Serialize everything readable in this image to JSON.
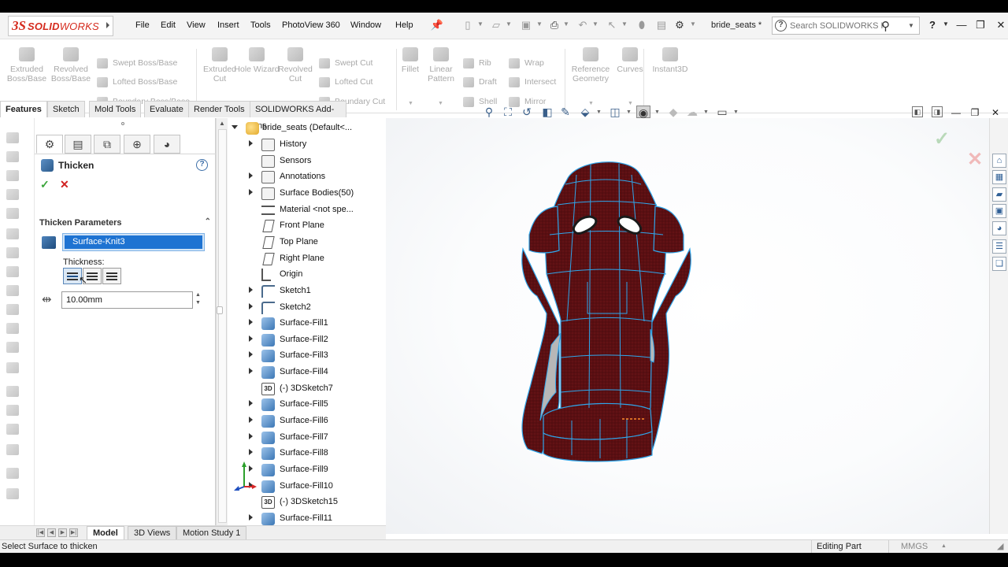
{
  "menu": {
    "brand_ds": "3S",
    "brand_solid": "SOLID",
    "brand_works": "WORKS",
    "items": [
      "File",
      "Edit",
      "View",
      "Insert",
      "Tools",
      "PhotoView 360",
      "Window",
      "Help"
    ],
    "document_title": "bride_seats *",
    "search_placeholder": "Search SOLIDWORKS Help"
  },
  "command_manager": {
    "extruded_boss": "Extruded Boss/Base",
    "revolved_boss": "Revolved Boss/Base",
    "swept_boss": "Swept Boss/Base",
    "lofted_boss": "Lofted Boss/Base",
    "boundary_boss": "Boundary Boss/Base",
    "extruded_cut": "Extruded Cut",
    "hole_wizard": "Hole Wizard",
    "revolved_cut": "Revolved Cut",
    "swept_cut": "Swept Cut",
    "lofted_cut": "Lofted Cut",
    "boundary_cut": "Boundary Cut",
    "fillet": "Fillet",
    "linear_pattern": "Linear Pattern",
    "rib": "Rib",
    "draft": "Draft",
    "shell": "Shell",
    "wrap": "Wrap",
    "intersect": "Intersect",
    "mirror": "Mirror",
    "reference_geometry": "Reference Geometry",
    "curves": "Curves",
    "instant3d": "Instant3D"
  },
  "tabs": [
    "Features",
    "Sketch",
    "Mold Tools",
    "Evaluate",
    "Render Tools",
    "SOLIDWORKS Add-Ins"
  ],
  "property_manager": {
    "title": "Thicken",
    "help": "?",
    "ok": "✓",
    "cancel": "✕",
    "group_title": "Thicken Parameters",
    "selected_face": "Surface-Knit3",
    "thickness_label": "Thickness:",
    "thickness_value": "10.00mm"
  },
  "feature_tree": {
    "root": "bride_seats  (Default<...",
    "items": [
      {
        "label": "History",
        "icon": "history-icon"
      },
      {
        "label": "Sensors",
        "icon": "sensors-icon"
      },
      {
        "label": "Annotations",
        "icon": "annotations-icon"
      },
      {
        "label": "Surface Bodies(50)",
        "icon": "surface-bodies-icon"
      },
      {
        "label": "Material <not spe...",
        "icon": "material-icon"
      },
      {
        "label": "Front Plane",
        "icon": "plane-icon"
      },
      {
        "label": "Top Plane",
        "icon": "plane-icon"
      },
      {
        "label": "Right Plane",
        "icon": "plane-icon"
      },
      {
        "label": "Origin",
        "icon": "origin-icon"
      },
      {
        "label": "Sketch1",
        "icon": "sketch-icon"
      },
      {
        "label": "Sketch2",
        "icon": "sketch-icon"
      },
      {
        "label": "Surface-Fill1",
        "icon": "surface-fill-icon"
      },
      {
        "label": "Surface-Fill2",
        "icon": "surface-fill-icon"
      },
      {
        "label": "Surface-Fill3",
        "icon": "surface-fill-icon"
      },
      {
        "label": "Surface-Fill4",
        "icon": "surface-fill-icon"
      },
      {
        "label": "(-) 3DSketch7",
        "icon": "3d-sketch-icon"
      },
      {
        "label": "Surface-Fill5",
        "icon": "surface-fill-icon"
      },
      {
        "label": "Surface-Fill6",
        "icon": "surface-fill-icon"
      },
      {
        "label": "Surface-Fill7",
        "icon": "surface-fill-icon"
      },
      {
        "label": "Surface-Fill8",
        "icon": "surface-fill-icon"
      },
      {
        "label": "Surface-Fill9",
        "icon": "surface-fill-icon"
      },
      {
        "label": "Surface-Fill10",
        "icon": "surface-fill-icon"
      },
      {
        "label": "(-) 3DSketch15",
        "icon": "3d-sketch-icon"
      },
      {
        "label": "Surface-Fill11",
        "icon": "surface-fill-icon"
      }
    ]
  },
  "bottom_tabs": [
    "Model",
    "3D Views",
    "Motion Study 1"
  ],
  "status": {
    "message": "Select Surface to thicken",
    "mode": "Editing Part",
    "units": "MMGS"
  },
  "colors": {
    "seat_fabric": "#5a0f12",
    "seat_edges": "#2fa6ea",
    "selection_blue": "#1e73d2",
    "brand_red": "#d52b1e"
  }
}
